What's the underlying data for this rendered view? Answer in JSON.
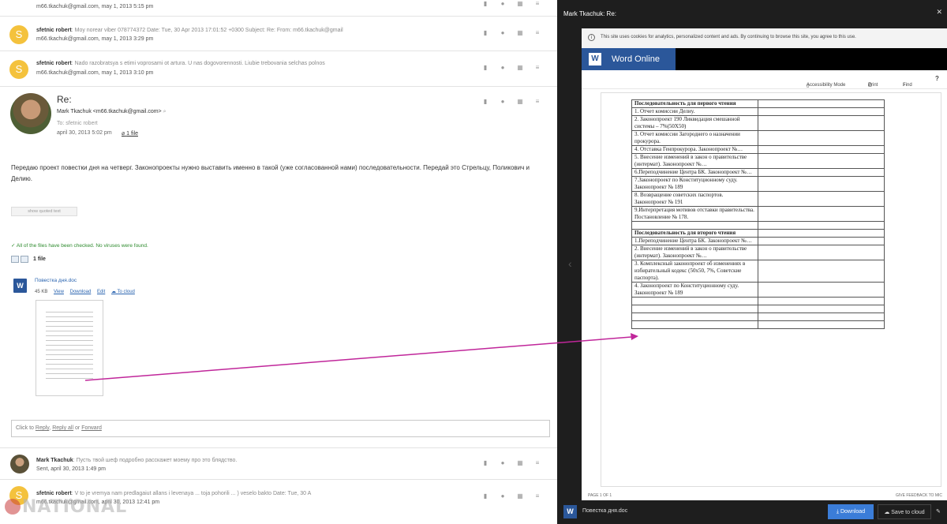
{
  "mail": {
    "top_partial": {
      "sender_email": "m66.tkachuk@gmail.com",
      "date": "may 1, 2013 5:15 pm"
    },
    "threads_top": [
      {
        "avatar_letter": "S",
        "sender": "sfetnic robert",
        "snippet": "Moy norear viber 078774372 Date: Tue, 30 Apr 2013 17:01:52 +0300 Subject: Re: From: m66.tkachuk@gmail",
        "email": "m66.tkachuk@gmail.com",
        "date": "may 1, 2013 3:29 pm"
      },
      {
        "avatar_letter": "S",
        "sender": "sfetnic robert",
        "snippet": "Nado razobratsya s etimi voprosami ot artura. U nas dogovorennosti. Liubie trebovania selchas polnos",
        "email": "m66.tkachuk@gmail.com",
        "date": "may 1, 2013 3:10 pm"
      }
    ],
    "open": {
      "subject": "Re:",
      "from": "Mark Tkachuk <m66.tkachuk@gmail.com>",
      "to": "To: sfetnic robert",
      "date": "april 30, 2013 5:02 pm",
      "files_link": "1 file",
      "body": "Передаю проект повестки дня на четверг. Законопроекты нужно выставить именно в такой (уже согласованной нами) последовательности. Передай это Стрельцу, Поликович и Делию.",
      "show_quoted": "show quoted text",
      "virus_check": "All of the files have been checked. No viruses were found.",
      "files_count": "1 file",
      "attachment": {
        "name": "Повестка дня.doc",
        "size": "45 KB",
        "view": "View",
        "download": "Download",
        "edit": "Edit",
        "to_cloud": "To cloud"
      },
      "reply_prefix": "Click to",
      "reply": "Reply",
      "reply_all": "Reply all",
      "reply_or": "or",
      "forward": "Forward"
    },
    "threads_bottom": [
      {
        "sender": "Mark Tkachuk",
        "snippet": "Пусть твой шеф подробно расскажет моему про это блядство.",
        "line2": "Sent, april 30, 2013 1:49 pm"
      },
      {
        "avatar_letter": "S",
        "sender": "sfetnic robert",
        "snippet": "V to je vremya nam predlagaiut allans i levenaya ... toja pohorili ... ) veselo bakto Date: Tue, 30 A",
        "line2": "m66.tkachuk@gmail.com, april 30, 2013 12:41 pm"
      }
    ]
  },
  "viewer": {
    "title": "Mark Tkachuk: Re:",
    "cookie_notice": "This site uses cookies for analytics, personalized content and ads. By continuing to browse this site, you agree to this use.",
    "app_name": "Word Online",
    "tools": {
      "accessibility": "Accessibility Mode",
      "print": "Print",
      "find": "Find",
      "help": "?"
    },
    "page_indicator": "PAGE 1 OF 1",
    "feedback": "GIVE FEEDBACK TO MIC",
    "file_name": "Повестка дня.doc",
    "download": "Download",
    "save_to_cloud": "Save to cloud"
  },
  "document": {
    "rows": [
      {
        "text": "Последовательность для первого чтения",
        "header": true
      },
      {
        "text": "1. Отчет комиссии Делиу."
      },
      {
        "text": "2. Законопроект 190 Ликвидация смешанной системы – 7%(50Х50)"
      },
      {
        "text": "3. Отчет комиссии Загороднего о назначении прокурора."
      },
      {
        "text": "4. Отставка Генпрокурора. Законопроект №…"
      },
      {
        "text": "5. Внесение изменений в закон о правительстве (интермат). Законопроект №…"
      },
      {
        "text": "6.Переподчинение Центра БК. Законопроект №…"
      },
      {
        "text": "7.Законопроект по Конституционному суду. Законопроект № 189"
      },
      {
        "text": "8. Возвращение советских паспортов. Законопроект № 191"
      },
      {
        "text": "9.Интерпретация мотивов отставки правительства. Постановление № 178."
      },
      {
        "text": ""
      },
      {
        "text": "Последовательность для второго чтения",
        "header": true
      },
      {
        "text": "1.Переподчинение Центра БК. Законопроект №…"
      },
      {
        "text": "2. Внесение изменений в закон о правительстве (интермат). Законопроект №…"
      },
      {
        "text": "3. Комплексный законопроект об изменениях в избирательный кодекс (50х50, 7%, Советские паспорта)."
      },
      {
        "text": "4. Законопроект по Конституционному суду. Законопроект № 189"
      },
      {
        "text": ""
      },
      {
        "text": ""
      },
      {
        "text": ""
      },
      {
        "text": ""
      }
    ]
  },
  "watermark": "NATIONAL",
  "colors": {
    "accent_word": "#2b579a",
    "annotation_arrow": "#c0269a",
    "avatar_yellow": "#f4c23d",
    "virus_ok_green": "#2e8b2e"
  }
}
